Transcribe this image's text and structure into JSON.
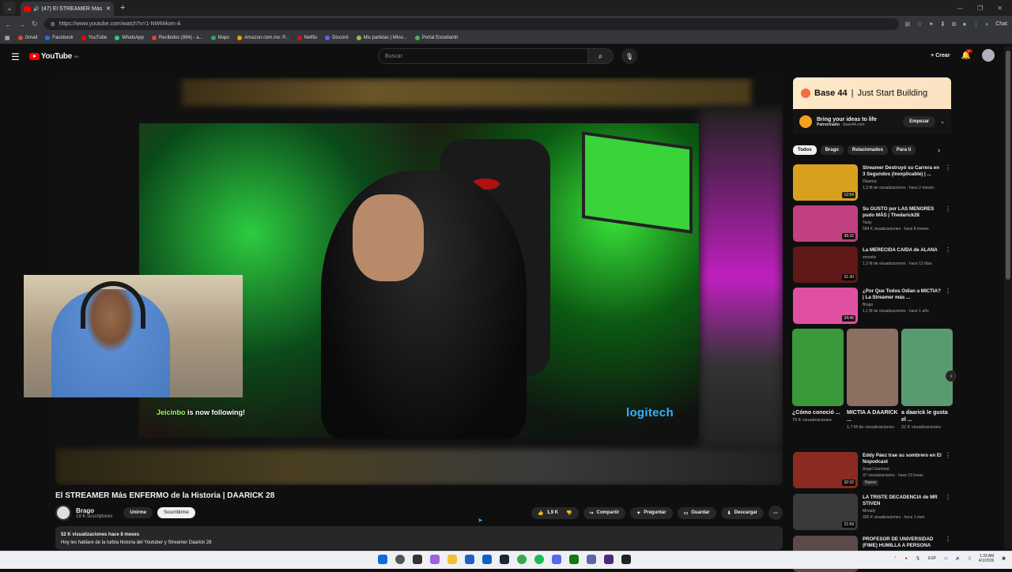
{
  "browser": {
    "tab_title": "(47) El STREAMER Más ENFERMO",
    "url": "https://www.youtube.com/watch?v=1-NWM4om-A",
    "chat_label": "Chat"
  },
  "bookmarks": [
    {
      "label": "Gmail",
      "color": "#ea4335"
    },
    {
      "label": "Facebook",
      "color": "#1877f2"
    },
    {
      "label": "YouTube",
      "color": "#ff0000"
    },
    {
      "label": "WhatsApp",
      "color": "#25d366"
    },
    {
      "label": "Recibidos (894) - a...",
      "color": "#ea4335"
    },
    {
      "label": "Maps",
      "color": "#34a853"
    },
    {
      "label": "Amazon.com.mx: P...",
      "color": "#ff9900"
    },
    {
      "label": "Netflix",
      "color": "#e50914"
    },
    {
      "label": "Discord",
      "color": "#5865f2"
    },
    {
      "label": "Mis partidas | Mine...",
      "color": "#8bc34a"
    },
    {
      "label": "Portal Estudiantil",
      "color": "#4caf50"
    }
  ],
  "header": {
    "logo_text": "YouTube",
    "logo_region": "MX",
    "search_placeholder": "Buscar",
    "create_label": "+ Crear",
    "notif_count": "9+"
  },
  "player": {
    "overlay_name": "Jeicinbo",
    "overlay_text": " is now following!",
    "sponsor": "logitech"
  },
  "video": {
    "title": "El STREAMER Más ENFERMO de la Historia | DAARICK 28",
    "channel": "Brago",
    "subscribers": "19 K suscriptores",
    "join_label": "Unirme",
    "subscribe_label": "Suscribirme",
    "likes": "1,9 K",
    "share_label": "Compartir",
    "ask_label": "Preguntar",
    "save_label": "Guardar",
    "download_label": "Descargar",
    "desc_meta": "52 K visualizaciones  hace 8 meses",
    "desc_text": "Hoy les hablare de la turbia historia del Youtuber y Streamer Daarick 28"
  },
  "ad": {
    "brand": "Base 44",
    "separator": "|",
    "tagline": "Just Start Building",
    "line1": "Bring your ideas to life",
    "sponsored": "Patrocinado",
    "domain": " · base44.com",
    "cta": "Empezar"
  },
  "chips": [
    "Todos",
    "Brago",
    "Relacionados",
    "Para ti"
  ],
  "recommendations": [
    {
      "title": "Streamer Destruyó su Carrera en 3 Segundos (Inexplicable) | ...",
      "channel": "Dkarma",
      "meta": "1,3 M de visualizaciones · hace 2 meses",
      "duration": "12:54",
      "color": "#d9a020"
    },
    {
      "title": "Su GUSTO por LAS MENORES pudo MÁS | Thedarick28",
      "channel": "Tasty",
      "meta": "584 K visualizaciones · hace 8 meses",
      "duration": "36:32",
      "color": "#c04080"
    },
    {
      "title": "La MERECIDA CAÍDA de ALANA",
      "channel": "emzelie",
      "meta": "1,3 M de visualizaciones · hace 13 días",
      "duration": "31:30",
      "color": "#601818"
    },
    {
      "title": "¿Por Que Todos Odian a MICTIA? | La Streamer más ...",
      "channel": "Brago",
      "meta": "1,1 M de visualizaciones · hace 1 año",
      "duration": "24:46",
      "color": "#e050a0"
    }
  ],
  "shorts": [
    {
      "title": "¿Cómo conoció ...",
      "views": "79 K visualizaciones",
      "color": "#3a9a3a"
    },
    {
      "title": "MICTIA A DAARICK ...",
      "views": "1,7 M de visualizaciones",
      "color": "#8a7060"
    },
    {
      "title": "a daarick le gusta el ...",
      "views": "22 K visualizaciones",
      "color": "#5a9a70"
    }
  ],
  "recommendations2": [
    {
      "title": "Eddy Páez trae su sombrero en El Nopodcast",
      "channel": "Ángel Garmont",
      "meta": "37 visualizaciones · hace 13 horas",
      "badge": "Nuevo",
      "duration": "32:32",
      "color": "#8a2a20"
    },
    {
      "title": "LA TRISTE DECADENCIA de MR STIVEN",
      "channel": "Mrvady",
      "meta": "326 K visualizaciones · hace 1 mes",
      "duration": "21:59",
      "color": "#3a3a3a"
    },
    {
      "title": "PROFESOR DE UNIVERSIDAD (FIME) HUMILLA A PERSONA",
      "channel": "",
      "meta": "",
      "duration": "",
      "color": "#5a4a4a"
    }
  ],
  "taskbar": {
    "lang": "ESP",
    "time": "1:33 AM",
    "date": "4/1/2026"
  }
}
